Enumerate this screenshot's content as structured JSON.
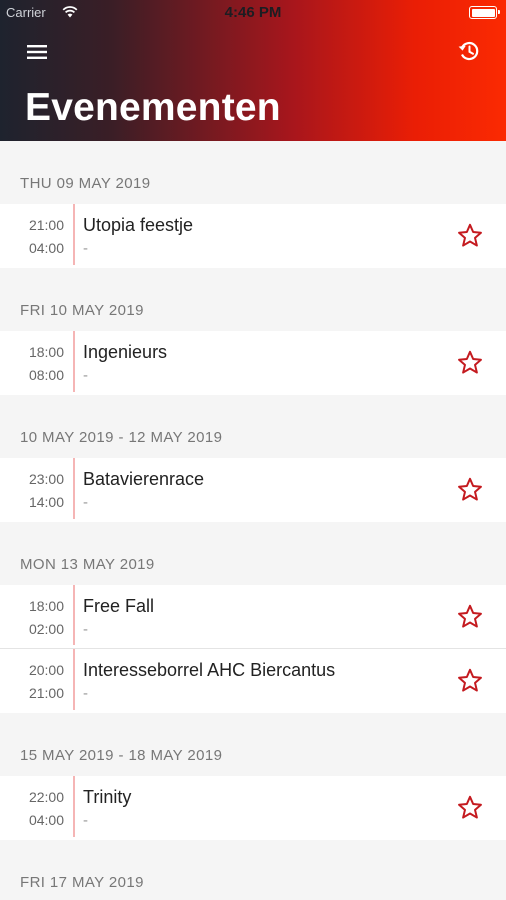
{
  "status_bar": {
    "carrier": "Carrier",
    "time": "4:46 PM"
  },
  "header": {
    "title": "Evenementen",
    "menu_icon": "hamburger-menu-icon",
    "history_icon": "history-icon"
  },
  "colors": {
    "accent": "#c8141e",
    "star": "#c41a1f",
    "header_start": "#1e232e",
    "header_end": "#fb2a02"
  },
  "sections": [
    {
      "date": "THU 09 MAY 2019",
      "events": [
        {
          "start": "21:00",
          "end": "04:00",
          "title": "Utopia feestje",
          "subtitle": "-"
        }
      ]
    },
    {
      "date": "FRI 10 MAY 2019",
      "events": [
        {
          "start": "18:00",
          "end": "08:00",
          "title": "Ingenieurs",
          "subtitle": "-"
        }
      ]
    },
    {
      "date": "10 MAY 2019 - 12 MAY 2019",
      "events": [
        {
          "start": "23:00",
          "end": "14:00",
          "title": "Batavierenrace",
          "subtitle": "-"
        }
      ]
    },
    {
      "date": "MON 13 MAY 2019",
      "events": [
        {
          "start": "18:00",
          "end": "02:00",
          "title": "Free Fall",
          "subtitle": "-"
        },
        {
          "start": "20:00",
          "end": "21:00",
          "title": "Interesseborrel AHC Biercantus",
          "subtitle": "-"
        }
      ]
    },
    {
      "date": "15 MAY 2019 - 18 MAY 2019",
      "events": [
        {
          "start": "22:00",
          "end": "04:00",
          "title": "Trinity",
          "subtitle": "-"
        }
      ]
    },
    {
      "date": "FRI 17 MAY 2019",
      "events": []
    }
  ]
}
